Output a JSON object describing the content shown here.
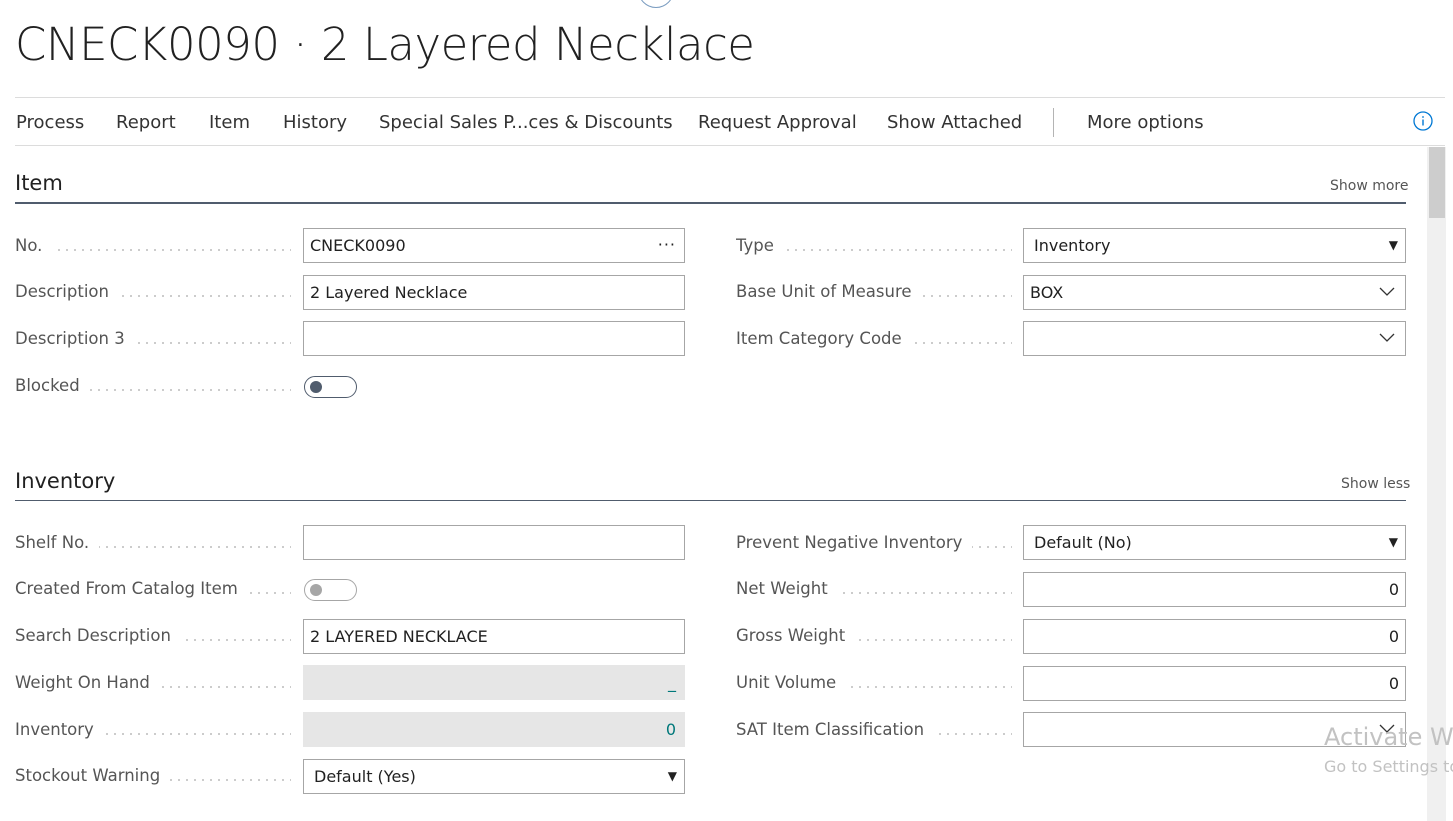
{
  "page": {
    "title": "CNECK0090 · 2 Layered Necklace"
  },
  "action_bar": {
    "items": [
      "Process",
      "Report",
      "Item",
      "History",
      "Special Sales P...ces & Discounts",
      "Request Approval",
      "Show Attached"
    ],
    "more": "More options"
  },
  "item_section": {
    "title": "Item",
    "toggle": "Show more",
    "fields": {
      "no": {
        "label": "No.",
        "value": "CNECK0090"
      },
      "description": {
        "label": "Description",
        "value": "2 Layered Necklace"
      },
      "description3": {
        "label": "Description 3",
        "value": ""
      },
      "blocked": {
        "label": "Blocked",
        "checked": false
      },
      "type": {
        "label": "Type",
        "value": "Inventory"
      },
      "base_uom": {
        "label": "Base Unit of Measure",
        "value": "BOX"
      },
      "item_category": {
        "label": "Item Category Code",
        "value": ""
      }
    }
  },
  "inventory_section": {
    "title": "Inventory",
    "toggle": "Show less",
    "fields": {
      "shelf_no": {
        "label": "Shelf No.",
        "value": ""
      },
      "created_from_catalog": {
        "label": "Created From Catalog Item",
        "checked": false
      },
      "search_description": {
        "label": "Search Description",
        "value": "2 LAYERED NECKLACE"
      },
      "weight_on_hand": {
        "label": "Weight On Hand",
        "value": "_"
      },
      "inventory": {
        "label": "Inventory",
        "value": "0"
      },
      "stockout_warning": {
        "label": "Stockout Warning",
        "value": "Default (Yes)"
      },
      "prevent_negative": {
        "label": "Prevent Negative Inventory",
        "value": "Default (No)"
      },
      "net_weight": {
        "label": "Net Weight",
        "value": "0"
      },
      "gross_weight": {
        "label": "Gross Weight",
        "value": "0"
      },
      "unit_volume": {
        "label": "Unit Volume",
        "value": "0"
      },
      "sat_classification": {
        "label": "SAT Item Classification",
        "value": ""
      }
    }
  },
  "watermark": {
    "line1": "Activate Wi",
    "line2": "Go to Settings to"
  },
  "colors": {
    "accent": "#505c6d",
    "field_border": "#a6a6a6",
    "readonly_bg": "#e6e6e6",
    "number_teal": "#00787a"
  }
}
